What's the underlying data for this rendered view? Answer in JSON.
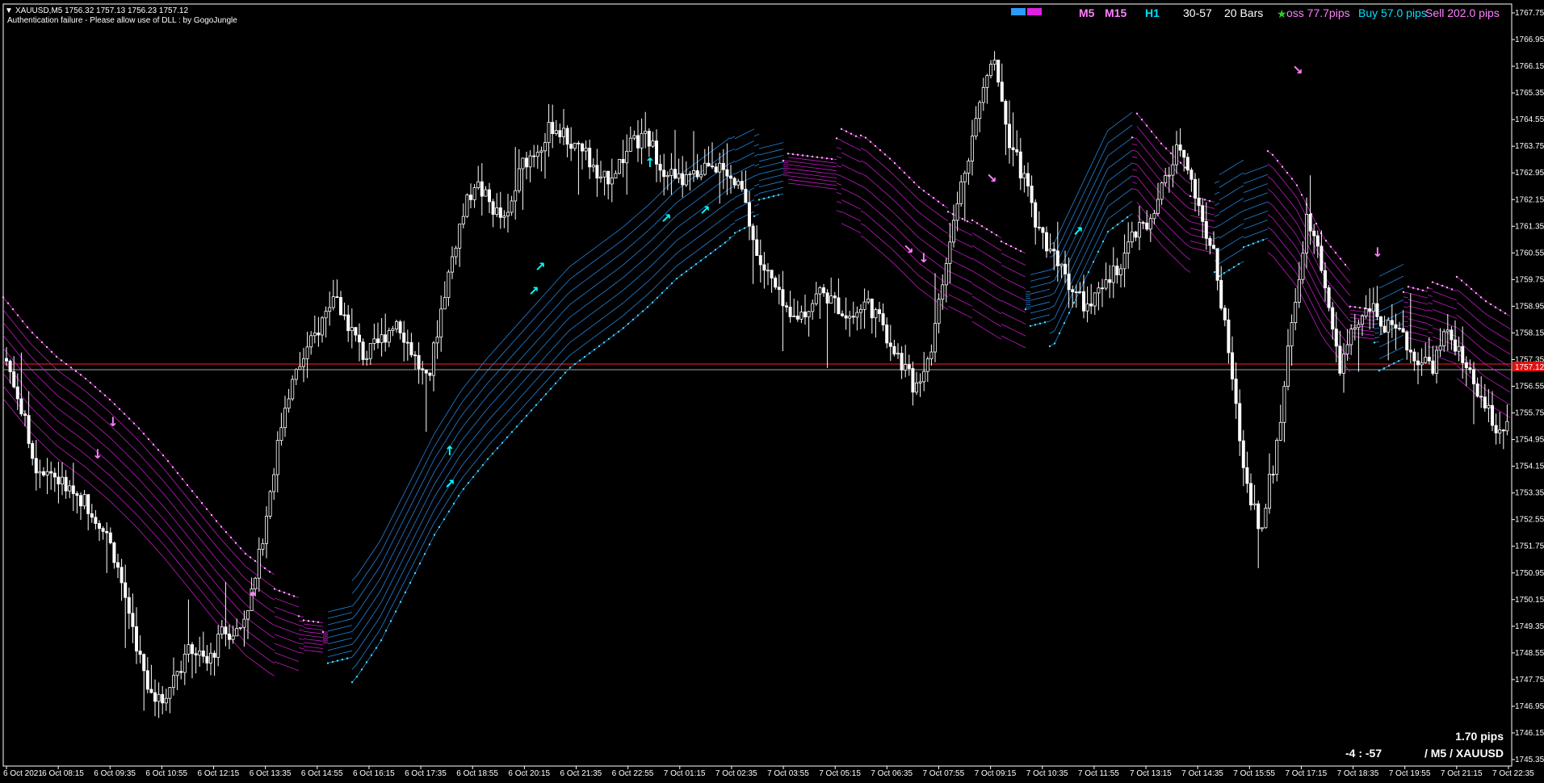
{
  "header": {
    "symbol_line": "XAUUSD,M5  1756.32 1757.13 1756.23 1757.12",
    "auth_message": "Authentication failure - Please allow use of DLL : by GogoJungle"
  },
  "hud": {
    "tf_m5": "M5",
    "tf_m15": "M15",
    "tf_h1": "H1",
    "range": "30-57",
    "bars": "20 Bars",
    "loss": "oss 77.7pips",
    "buy": "Buy 57.0 pips",
    "sell": "Sell 202.0 pips",
    "pips_value": "1.70 pips",
    "score": "-4 : -57",
    "pair_tf": "/ M5 / XAUUSD"
  },
  "colors": {
    "background": "#000000",
    "candle": "#ffffff",
    "up_ribbon": "#2b9bff",
    "down_ribbon": "#e020e0",
    "up_arrow": "#00ffff",
    "down_arrow": "#ff80ff",
    "level_red": "#ff2020",
    "level_gray": "#a0a0a0",
    "price_tag_bg": "#e11",
    "green_star": "#27d227"
  },
  "price_tag": "1757.12",
  "chart_data": {
    "type": "candlestick",
    "symbol": "XAUUSD",
    "timeframe": "M5",
    "y_ticks": [
      "1767.75",
      "1766.95",
      "1766.15",
      "1765.35",
      "1764.55",
      "1763.75",
      "1762.95",
      "1762.15",
      "1761.35",
      "1760.55",
      "1759.75",
      "1758.95",
      "1758.15",
      "1757.35",
      "1756.55",
      "1755.75",
      "1754.95",
      "1754.15",
      "1753.35",
      "1752.55",
      "1751.75",
      "1750.95",
      "1750.15",
      "1749.35",
      "1748.55",
      "1747.75",
      "1746.95",
      "1746.15",
      "1745.35"
    ],
    "ylim": [
      1745.35,
      1767.75
    ],
    "x_ticks": [
      "6 Oct 2021",
      "6 Oct 08:15",
      "6 Oct 09:35",
      "6 Oct 10:55",
      "6 Oct 12:15",
      "6 Oct 13:35",
      "6 Oct 14:55",
      "6 Oct 16:15",
      "6 Oct 17:35",
      "6 Oct 18:55",
      "6 Oct 20:15",
      "6 Oct 21:35",
      "6 Oct 22:55",
      "7 Oct 01:15",
      "7 Oct 02:35",
      "7 Oct 03:55",
      "7 Oct 05:15",
      "7 Oct 06:35",
      "7 Oct 07:55",
      "7 Oct 09:15",
      "7 Oct 10:35",
      "7 Oct 11:55",
      "7 Oct 13:15",
      "7 Oct 14:35",
      "7 Oct 15:55",
      "7 Oct 17:15",
      "7 Oct 18:35",
      "7 Oct 19:55",
      "7 Oct 21:15",
      "7 Oct 22:35"
    ],
    "close_path": [
      1757.6,
      1756.2,
      1754.2,
      1754.0,
      1753.5,
      1753.2,
      1752.6,
      1751.6,
      1749.8,
      1747.8,
      1747.0,
      1748.0,
      1748.7,
      1748.2,
      1749.2,
      1749.2,
      1750.6,
      1753.5,
      1756.2,
      1757.3,
      1758.2,
      1759.3,
      1758.4,
      1757.4,
      1757.9,
      1758.6,
      1757.6,
      1756.6,
      1759.2,
      1761.3,
      1762.7,
      1762.0,
      1761.4,
      1763.2,
      1763.7,
      1764.4,
      1763.9,
      1763.6,
      1762.6,
      1763.1,
      1763.8,
      1764.0,
      1763.1,
      1762.7,
      1762.8,
      1763.4,
      1762.8,
      1762.4,
      1760.4,
      1759.6,
      1758.5,
      1758.8,
      1759.4,
      1759.0,
      1758.6,
      1759.1,
      1758.3,
      1757.4,
      1756.5,
      1757.6,
      1760.2,
      1762.7,
      1764.7,
      1766.7,
      1764.0,
      1762.7,
      1761.1,
      1760.5,
      1759.5,
      1758.9,
      1759.4,
      1760.2,
      1761.1,
      1761.4,
      1762.8,
      1763.9,
      1762.0,
      1760.6,
      1757.5,
      1753.9,
      1752.3,
      1754.6,
      1758.4,
      1761.8,
      1760.0,
      1757.0,
      1758.3,
      1758.9,
      1758.3,
      1758.0,
      1757.4,
      1757.2,
      1758.3,
      1757.1,
      1756.2,
      1755.3,
      1755.3
    ],
    "ribbon_center": [
      1757.7,
      1756.7,
      1755.9,
      1755.3,
      1754.6,
      1753.8,
      1752.9,
      1751.9,
      1750.9,
      1750.0,
      1749.4,
      1749.1,
      1749.0,
      1749.2,
      1750.4,
      1752.0,
      1753.6,
      1754.9,
      1755.9,
      1756.8,
      1757.7,
      1758.6,
      1759.2,
      1759.8,
      1760.5,
      1761.3,
      1761.9,
      1762.5,
      1762.9,
      1763.1,
      1763.0,
      1762.9,
      1762.5,
      1761.8,
      1761.0,
      1760.4,
      1760.0,
      1759.5,
      1759.1,
      1759.3,
      1761.0,
      1762.7,
      1763.3,
      1762.3,
      1761.5,
      1761.3,
      1761.8,
      1762.1,
      1761.1,
      1759.5,
      1758.5,
      1758.4,
      1758.8,
      1758.6,
      1758.3,
      1757.6,
      1757.1
    ]
  }
}
